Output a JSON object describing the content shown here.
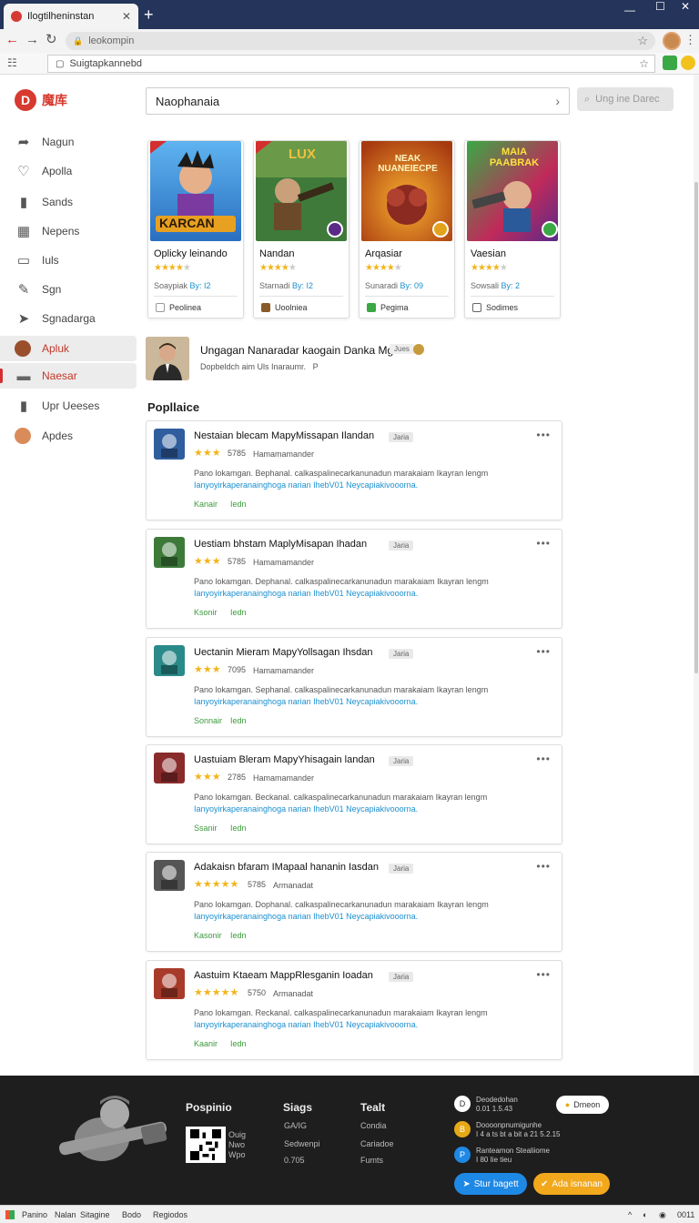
{
  "browser": {
    "tab_title": "Ilogtilheninstan",
    "address": "leokompin",
    "bookmark_search": "Suigtapkannebd"
  },
  "sidebar": {
    "brand": "魔库",
    "items": [
      {
        "label": "Nagun",
        "icon": "arrow-icon"
      },
      {
        "label": "Apolla",
        "icon": "heart-icon"
      },
      {
        "label": "Sands",
        "icon": "bookmark-icon"
      },
      {
        "label": "Nepens",
        "icon": "grid-icon"
      },
      {
        "label": "Iuls",
        "icon": "toggle-icon"
      },
      {
        "label": "Sgn",
        "icon": "wrench-icon"
      },
      {
        "label": "Sgnadarga",
        "icon": "play-icon"
      },
      {
        "label": "Apluk",
        "icon": "avatar-icon",
        "active": true
      },
      {
        "label": "Naesar",
        "icon": "bookmark-icon",
        "active": true
      },
      {
        "label": "Upr Ueeses",
        "icon": "bookmark-icon"
      },
      {
        "label": "Apdes",
        "icon": "avatar-icon"
      }
    ]
  },
  "search": {
    "value": "Naophanaia",
    "button_placeholder": "Ung ine Darec"
  },
  "cards": [
    {
      "name": "Oplicky leinando",
      "meta_a": "Soaypiak",
      "meta_b": "By: I2",
      "foot": "Peolinea",
      "rating": 4,
      "art_title": "KARCAN",
      "badge": "#d32f2f"
    },
    {
      "name": "Nandan",
      "meta_a": "Starnadi",
      "meta_b": "By: I2",
      "foot": "Uoolniea",
      "rating": 4,
      "art_title": "LUX",
      "badge": "#5b2a86"
    },
    {
      "name": "Arqasiar",
      "meta_a": "Sunaradi",
      "meta_b": "By: 09",
      "foot": "Pegima",
      "rating": 4,
      "art_title": "NEAK NUANEIECPE",
      "badge": "#e3a21a"
    },
    {
      "name": "Vaesian",
      "meta_a": "Sowsali",
      "meta_b": "By: 2",
      "foot": "Sodimes",
      "rating": 4,
      "art_title": "MAIA PAABRAK",
      "badge": "#3aa845"
    }
  ],
  "featured": {
    "title": "Ungagan Nanaradar kaogain Danka Mg",
    "tag": "Jues",
    "subtitle": "Dopbeldch aim Uls Inaraumr.",
    "subtitle_mark": "P"
  },
  "section_title": "Popllaice",
  "list": [
    {
      "title": "Nestaian blecam MapyMissapan Ilandan",
      "stars": "★★★",
      "num": "5785",
      "author": "Hamamamander",
      "tag": "Jaria",
      "desc1": "Pano lokamgan. Bephanal. calkaspalinecarkanunadun  marakaiam Ikayran lengm",
      "desc2": "Ianyoyirkaperanainghoga narian IhebV01 Neycapiakivooorna.",
      "link1": "Kanair",
      "link2": "Iedn",
      "icon_bg": "#2f5d9e"
    },
    {
      "title": "Uestiam bhstam MaplyMisapan Ihadan",
      "stars": "★★★",
      "num": "5785",
      "author": "Hamamamander",
      "tag": "Jaria",
      "desc1": "Pano lokamgan. Dephanal. calkaspalinecarkanunadun  marakaiam Ikayran lengm",
      "desc2": "Ianyoyirkaperanainghoga narian IhebV01 Neycapiakivooorna.",
      "link1": "Ksonir",
      "link2": "Iedn",
      "icon_bg": "#3d7a3a"
    },
    {
      "title": "Uectanin Mieram MapyYollsagan Ihsdan",
      "stars": "★★★",
      "num": "7095",
      "author": "Hamamamander",
      "tag": "Jaria",
      "desc1": "Pano lokamgan. Sephanal. calkaspalinecarkanunadun  marakaiam Ikayran lengm",
      "desc2": "Ianyoyirkaperanainghoga narian IhebV01 Neycapiakivooorna.",
      "link1": "Sonnair",
      "link2": "Iedn",
      "icon_bg": "#2a8a8a"
    },
    {
      "title": "Uastuiam Bleram MapyYhisagain landan",
      "stars": "★★★",
      "num": "2785",
      "author": "Hamamamander",
      "tag": "Jaria",
      "desc1": "Pano lokamgan. Beckanal. calkaspalinecarkanunadun  marakaiam Ikayran lengm",
      "desc2": "Ianyoyirkaperanainghoga narian IhebV01 Neycapiakivooorna.",
      "link1": "Ssanir",
      "link2": "Iedn",
      "icon_bg": "#8a2b2b"
    },
    {
      "title": "Adakaisn bfaram IMapaal hananin Iasdan",
      "stars": "★★★★★",
      "num": "5785",
      "author": "Armanadat",
      "tag": "Jaria",
      "desc1": "Pano lokamgan. Dophanal. calkaspalinecarkanunadun  marakaiam Ikayran lengm",
      "desc2": "Ianyoyirkaperanainghoga narian IhebV01 Neycapiakivooorna.",
      "link1": "Kasonir",
      "link2": "Iedn",
      "icon_bg": "#555555"
    },
    {
      "title": "Aastuim Ktaeam MappRlesganin Ioadan",
      "stars": "★★★★★",
      "num": "5750",
      "author": "Armanadat",
      "tag": "Jaria",
      "desc1": "Pano lokamgan. Reckanal. calkaspalinecarkanunadun  marakaiam Ikayran lengm",
      "desc2": "Ianyoyirkaperanainghoga narian IhebV01 Neycapiakivooorna.",
      "link1": "Kaanir",
      "link2": "Iedn",
      "icon_bg": "#a83a2a"
    }
  ],
  "footer": {
    "col1_title": "Pospinio",
    "qr_side": "Ouig Nwo Wpo",
    "col2_title": "Siags",
    "col2_links": [
      "GA/IG",
      "Sedwenpi",
      "0.705"
    ],
    "col3_title": "Tealt",
    "col3_links": [
      "Condia",
      "Cariadoe",
      "Fumts"
    ],
    "social": [
      {
        "line1": "Deodedohan",
        "line2": "0.01 1.5.43",
        "color": "#ffffff",
        "glyph": "D"
      },
      {
        "line1": "Doooonpnumigunhe",
        "line2": "I 4 a ts bt a  bit a 21 5.2.15",
        "color": "#e6a817",
        "glyph": "B"
      },
      {
        "line1": "Ranteamon Stealiiome",
        "line2": "I 80 Iie tieu",
        "color": "#1e88e5",
        "glyph": "P"
      }
    ],
    "pill": "Dmeon",
    "btn_blue": "Stur bagett",
    "btn_yellow": "Ada isnanan"
  },
  "status": {
    "items": [
      "Panino",
      "Nalan",
      "Sitagine",
      "Bodo",
      "Regiodos"
    ],
    "right": "0011"
  }
}
